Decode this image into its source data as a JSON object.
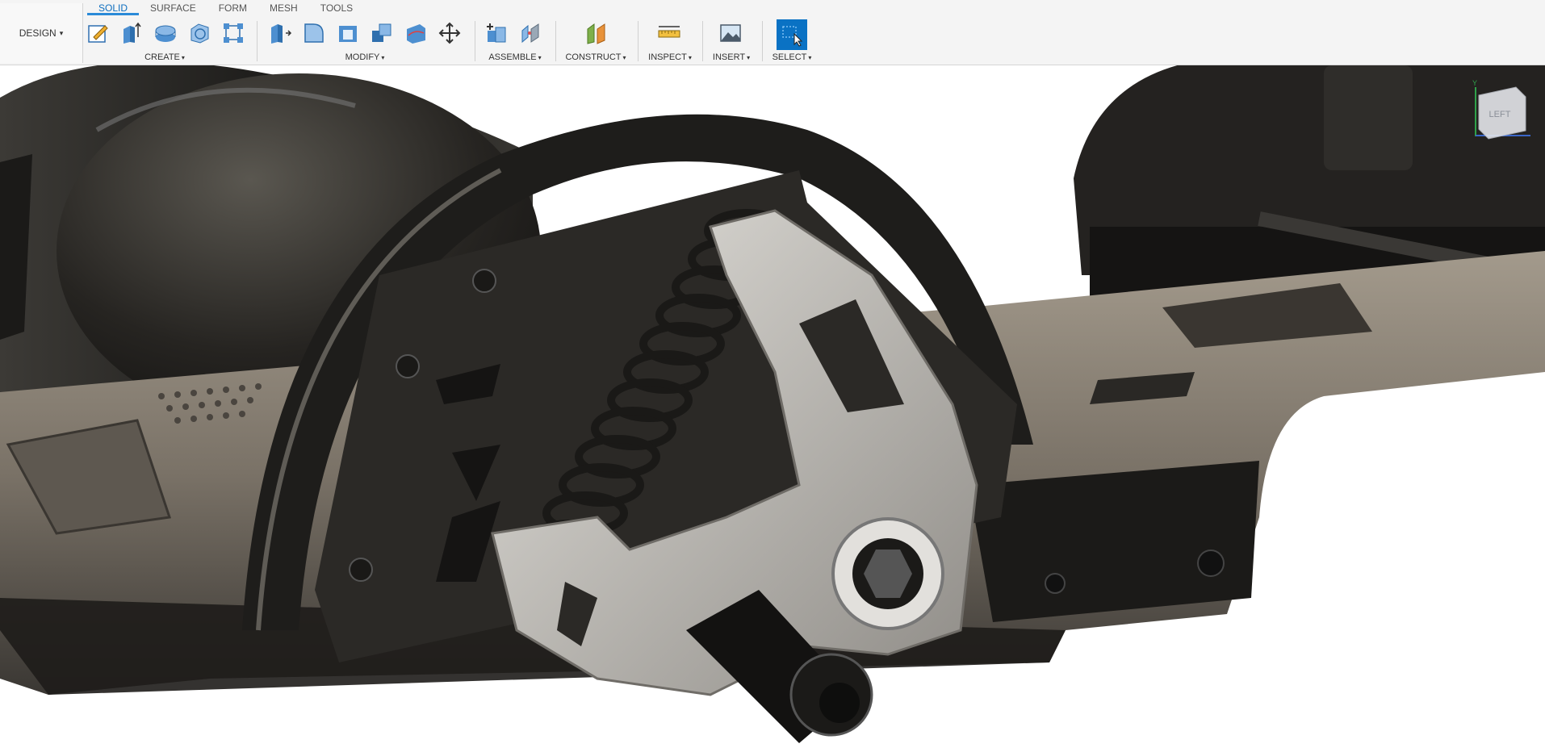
{
  "workspace": {
    "label": "DESIGN"
  },
  "tabs": [
    {
      "label": "SOLID",
      "active": true
    },
    {
      "label": "SURFACE",
      "active": false
    },
    {
      "label": "FORM",
      "active": false
    },
    {
      "label": "MESH",
      "active": false
    },
    {
      "label": "TOOLS",
      "active": false
    }
  ],
  "groups": {
    "create": {
      "label": "CREATE"
    },
    "modify": {
      "label": "MODIFY"
    },
    "assemble": {
      "label": "ASSEMBLE"
    },
    "construct": {
      "label": "CONSTRUCT"
    },
    "inspect": {
      "label": "INSPECT"
    },
    "insert": {
      "label": "INSERT"
    },
    "select": {
      "label": "SELECT"
    }
  },
  "viewcube": {
    "face_label": "LEFT",
    "axis_y": "Y"
  },
  "colors": {
    "accent": "#0d6ebf",
    "select_blue": "#0a72c4",
    "body_dark": "#2b2926",
    "bracket_gray": "#b9b7b2"
  }
}
